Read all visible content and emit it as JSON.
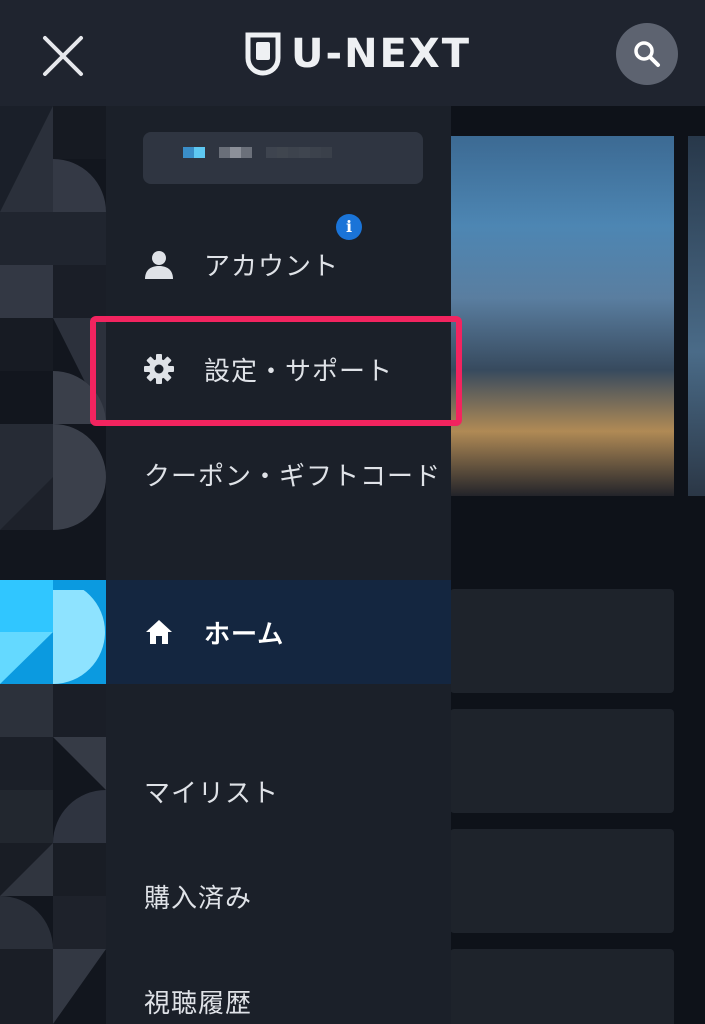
{
  "header": {
    "logo_text": "U-NEXT",
    "close_icon": "close-icon",
    "search_icon": "search-icon"
  },
  "drawer": {
    "profile": {
      "name_hidden": true
    },
    "info_badge": "i",
    "items": [
      {
        "label": "アカウント",
        "icon": "person-icon"
      },
      {
        "label": "設定・サポート",
        "icon": "gear-icon"
      },
      {
        "label": "クーポン・ギフトコード",
        "icon": ""
      },
      {
        "label": "ホーム",
        "icon": "home-icon",
        "selected": true
      },
      {
        "label": "マイリスト",
        "icon": ""
      },
      {
        "label": "購入済み",
        "icon": ""
      },
      {
        "label": "視聴履歴",
        "icon": ""
      }
    ]
  },
  "colors": {
    "header_bg": "#1f242f",
    "drawer_bg": "#1b2029",
    "selected_bg": "#142640",
    "highlight": "#f2245f",
    "info_badge": "#1a74d8"
  }
}
